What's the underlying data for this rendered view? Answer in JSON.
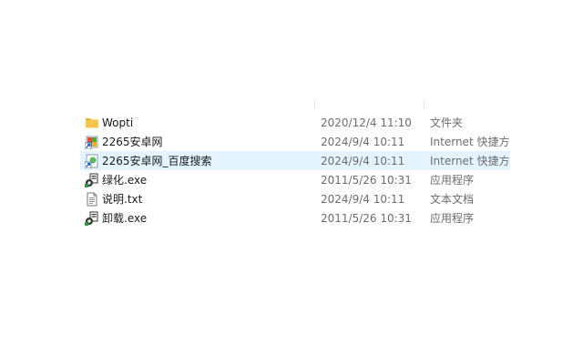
{
  "files": [
    {
      "name": "Wopti",
      "date": "2020/12/4 11:10",
      "type": "文件夹",
      "icon": "folder-icon"
    },
    {
      "name": "2265安卓网",
      "date": "2024/9/4 10:11",
      "type": "Internet 快捷方式",
      "icon": "internet-shortcut-icon"
    },
    {
      "name": "2265安卓网_百度搜索",
      "date": "2024/9/4 10:11",
      "type": "Internet 快捷方式",
      "icon": "internet-shortcut-icon"
    },
    {
      "name": "绿化.exe",
      "date": "2011/5/26 10:31",
      "type": "应用程序",
      "icon": "application-icon"
    },
    {
      "name": "说明.txt",
      "date": "2024/9/4 10:11",
      "type": "文本文档",
      "icon": "text-document-icon"
    },
    {
      "name": "卸载.exe",
      "date": "2011/5/26 10:31",
      "type": "应用程序",
      "icon": "application-icon"
    }
  ],
  "colors": {
    "hover_row": "#e5f3ff",
    "folder": "#f6c64f",
    "secondary_text": "#6d6d6d"
  }
}
